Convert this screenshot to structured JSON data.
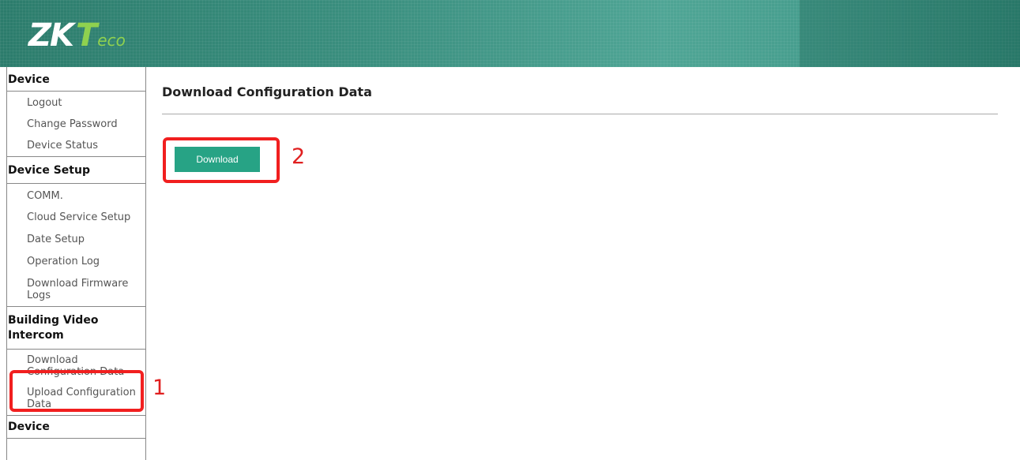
{
  "header": {
    "logo_zk": "ZK",
    "logo_t": "T",
    "logo_eco": "eco"
  },
  "sidebar": {
    "sections": [
      {
        "title": "Device",
        "items": [
          "Logout",
          "Change Password",
          "Device Status"
        ]
      },
      {
        "title": "Device Setup",
        "items": [
          "COMM.",
          "Cloud Service Setup",
          "Date Setup",
          "Operation Log",
          "Download Firmware Logs"
        ]
      },
      {
        "title": "Building Video Intercom",
        "items": [
          "Download Configuration Data",
          "Upload Configuration Data"
        ]
      },
      {
        "title": "Device"
      }
    ]
  },
  "main": {
    "title": "Download Configuration Data",
    "download_label": "Download"
  },
  "annotations": {
    "step1": "1",
    "step2": "2"
  },
  "colors": {
    "header": "#3a8e7e",
    "button": "#27a385",
    "annotation": "#f11f1f",
    "logo_accent": "#8fd14f"
  }
}
